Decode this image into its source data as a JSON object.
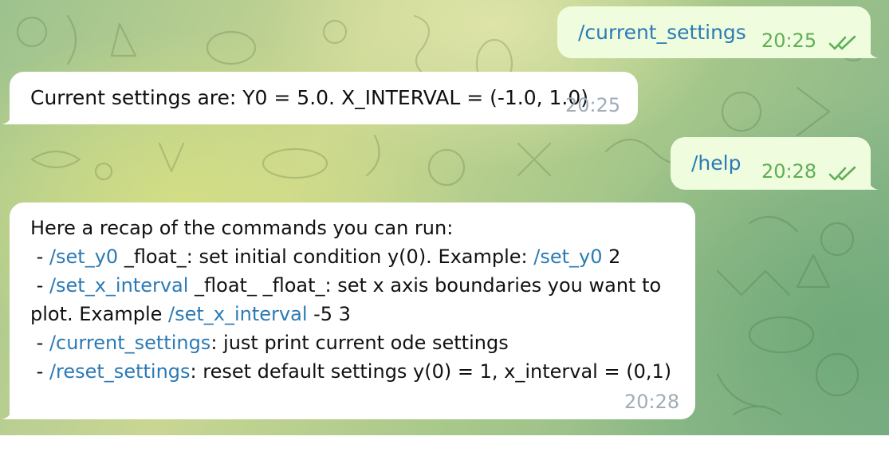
{
  "messages": [
    {
      "direction": "outgoing",
      "text": "/current_settings",
      "time": "20:25",
      "status": "read"
    },
    {
      "direction": "incoming",
      "text": "Current settings are: Y0 = 5.0. X_INTERVAL = (-1.0, 1.0)",
      "time": "20:25"
    },
    {
      "direction": "outgoing",
      "text": "/help",
      "time": "20:28",
      "status": "read"
    },
    {
      "direction": "incoming",
      "time": "20:28",
      "intro": "Here a recap of the commands you can run:",
      "lines": [
        {
          "prefix": "- ",
          "cmd": "/set_y0",
          "mid": " _float_: set initial condition y(0). Example: ",
          "cmd2": "/set_y0",
          "suffix": " 2"
        },
        {
          "prefix": "- ",
          "cmd": "/set_x_interval",
          "mid": " _float_ _float_: set x axis boundaries you want to"
        },
        {
          "mid": "plot. Example ",
          "cmd2": "/set_x_interval",
          "suffix": " -5 3"
        },
        {
          "prefix": "- ",
          "cmd": "/current_settings",
          "mid": ": just print current ode settings"
        },
        {
          "prefix": "- ",
          "cmd": "/reset_settings",
          "mid": ": reset default settings y(0) = 1, x_interval = (0,1)"
        }
      ]
    }
  ],
  "colors": {
    "outgoing_bubble": "#effdde",
    "incoming_bubble": "#ffffff",
    "command_link": "#2b7ab5",
    "outgoing_time": "#5fae56",
    "incoming_time": "#a0acb6"
  },
  "icons": {
    "read_status": "double-check-icon",
    "background": "doodle-pattern"
  }
}
